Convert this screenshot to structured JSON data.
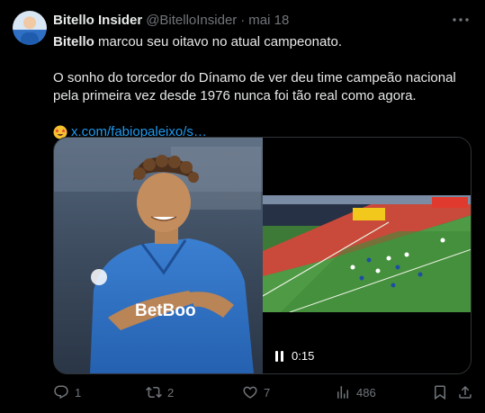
{
  "author": {
    "display_name": "Bitello Insider",
    "handle": "@BitelloInsider",
    "separator": "·",
    "date": "mai 18"
  },
  "post": {
    "line1_bold": "Bitello",
    "line1_rest": " marcou seu oitavo no atual campeonato.",
    "paragraph2": "O sonho do torcedor do Dínamo de ver deu time campeão nacional pela primeira vez desde 1976 nunca foi tão real como agora.",
    "link_text": "x.com/fabiopaleixo/s…"
  },
  "media": {
    "video_time": "0:15"
  },
  "actions": {
    "replies": "1",
    "reposts": "2",
    "likes": "7",
    "views": "486"
  },
  "icons": {
    "avatar": "avatar-image",
    "more": "more-icon",
    "reply": "reply-icon",
    "repost": "repost-icon",
    "like": "heart-icon",
    "views": "views-icon",
    "bookmark": "bookmark-icon",
    "share": "share-icon",
    "emoji": "star-struck-emoji-icon",
    "pause": "pause-icon"
  },
  "colors": {
    "background": "#000000",
    "text_primary": "#e7e9ea",
    "text_secondary": "#71767b",
    "link": "#1d9bf0",
    "border": "#2f3336"
  }
}
